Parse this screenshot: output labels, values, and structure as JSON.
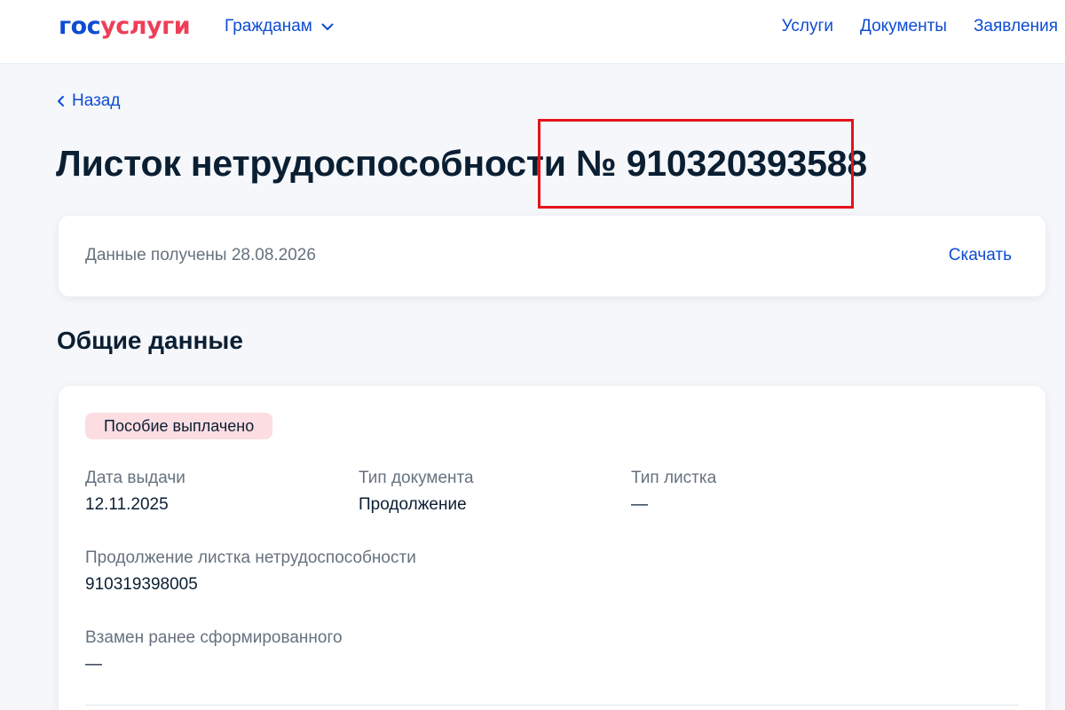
{
  "header": {
    "logo": {
      "part1": "гос",
      "part2": "услуги"
    },
    "menu_label": "Гражданам",
    "nav": [
      "Услуги",
      "Документы",
      "Заявления"
    ]
  },
  "back_label": "Назад",
  "title": {
    "prefix": "Листок нетрудоспособности",
    "number": "№ 910320393588"
  },
  "received": {
    "text": "Данные получены 28.08.2026",
    "download_label": "Скачать"
  },
  "general": {
    "section_title": "Общие данные",
    "status": "Пособие выплачено",
    "fields": {
      "issue_date": {
        "label": "Дата выдачи",
        "value": "12.11.2025"
      },
      "doc_type": {
        "label": "Тип документа",
        "value": "Продолжение"
      },
      "sheet_type": {
        "label": "Тип листка",
        "value": "—"
      },
      "continuation": {
        "label": "Продолжение листка нетрудоспособности",
        "value": "910319398005"
      },
      "replacement": {
        "label": "Взамен ранее сформированного",
        "value": "—"
      }
    }
  },
  "colors": {
    "brand_blue": "#0d4cd3",
    "brand_red": "#ee3f58",
    "highlight_border": "#e5121b",
    "badge_bg": "#fbdde2",
    "page_bg": "#f5f7fa"
  }
}
